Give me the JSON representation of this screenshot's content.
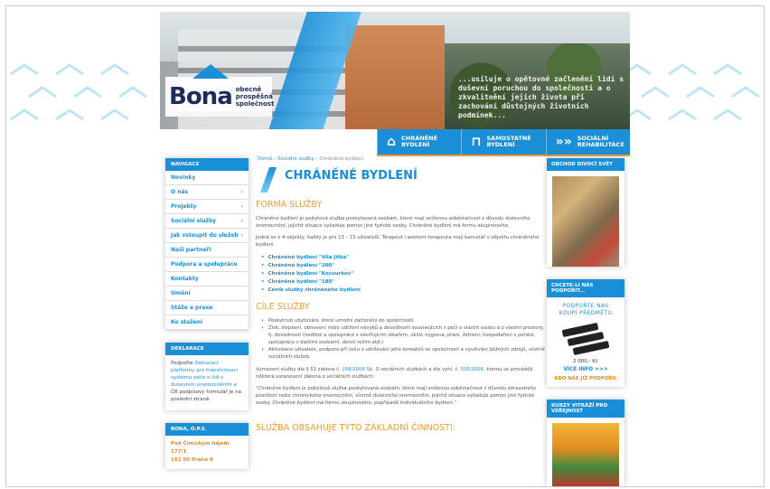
{
  "header": {
    "logo_name": "Bona",
    "logo_tag_1": "obecně",
    "logo_tag_2": "prospěšná",
    "logo_tag_3": "společnost",
    "slogan": "...usiluje o opětovné začlenění lidí s duševní poruchou do společnosti a o zkvalitnění jejich života při zachování důstojných životních podmínek..."
  },
  "topnav": [
    {
      "label_1": "CHRÁNĚNÉ",
      "label_2": "BYDLENÍ",
      "icon": "house-icon"
    },
    {
      "label_1": "SAMOSTATNÉ",
      "label_2": "BYDLENÍ",
      "icon": "door-icon"
    },
    {
      "label_1": "SOCIÁLNÍ",
      "label_2": "REHABILITACE",
      "icon": "chevrons-icon"
    }
  ],
  "sidebar": {
    "heading": "NAVIGACE",
    "items": [
      {
        "label": "Novinky",
        "arrow": ""
      },
      {
        "label": "O nás",
        "arrow": "›"
      },
      {
        "label": "Projekty",
        "arrow": "›"
      },
      {
        "label": "Sociální služby",
        "arrow": "›"
      },
      {
        "label": "Jak vstoupit do služeb",
        "arrow": "›"
      },
      {
        "label": "Naši partneři",
        "arrow": ""
      },
      {
        "label": "Podpora a spolupráce",
        "arrow": ""
      },
      {
        "label": "Kontakty",
        "arrow": ""
      },
      {
        "label": "Umění",
        "arrow": ""
      },
      {
        "label": "Stáže a praxe",
        "arrow": ""
      },
      {
        "label": "Ke stažení",
        "arrow": ""
      }
    ],
    "declaration": {
      "heading": "DEKLARACE",
      "text_1": "Podpořte",
      "link": "Deklaraci platformy pro transformaci systému péče o lidi s duševním onemocněním",
      "text_2": "v ČR podpisový formulář je na poslední straně."
    },
    "contact": {
      "heading": "BONA, O.P.S.",
      "line_1": "Pod Čimickým hájem 177/1",
      "line_2": "181 00 Praha 8"
    }
  },
  "main": {
    "breadcrumb_home": "Domů",
    "breadcrumb_sep": "›",
    "breadcrumb_parent": "Sociální služby",
    "breadcrumb_current": "Chráněné bydlení",
    "title": "CHRÁNĚNÉ BYDLENÍ",
    "section1": "FORMA SLUŽBY",
    "p1": "Chráněné bydlení je pobytová služba poskytovaná osobám, které mají sníženou soběstačnost z důvodu duševního onemocnění, jejichž situace vyžaduje pomoc jiné fyzické osoby. Chráněné bydlení má formu skupinového.",
    "p2": "Jedná se o 4 objekty, každý je pro 13 – 15 uživatelů. Terapeut i asistent terapeuta mají kancelář v objektu chráněného bydlení.",
    "links": [
      "Chráněné bydlení \"Vila Jitka\"",
      "Chráněné bydlení \"200\"",
      "Chráněné bydlení \"Kocourkov\"",
      "Chráněné bydlení \"180\"",
      "Ceník služby chráněného bydlení"
    ],
    "section2": "CÍLE SLUŽBY",
    "goals": [
      "Poskytnutí ubytování, které umožní začlenění do společnosti.",
      "Získ, zlepšení, obnovení nebo udržení návyků a dovedností souvisejících s péčí o vlastní osobu a o vlastní prostory, tj. dovednosti (nedílné a spolupráce s ošetřujícím lékařem, úklid, hygiena, praní, žehlení, hospodaření s penězi, spolupráce s dalšími osobami, denní režim atd.)",
      "Aktivizace uživatele, podpora při úsilu o udržování jeho kontaktů se společností a využívání běžných zdrojů, včetně sociálních služeb."
    ],
    "p3_a": "Vymezení služby dle § 51 zákona č.",
    "p3_link1": "108/2006 Sb.",
    "p3_b": "O sociálních službách a dle vyhl. č.",
    "p3_link2": "505/2006",
    "p3_c": ", kterou se provádějí některá ustanovení zákona o sociálních službách:",
    "p4": "\"Chráněné bydlení je pobytová služba poskytovaná osobám, které mají sníženou soběstačnost z důvodu zdravotního postižení nebo chronického onemocnění, včetně duševního onemocnění, jejichž situace vyžaduje pomoc jiné fyzické osoby. Chráněné bydlení má formu skupinového, popřípadě individuálního bydlení.\"",
    "section3": "SLUŽBA OBSAHUJE TYTO ZÁKLADNÍ ČINNOSTI:"
  },
  "right": {
    "shop_heading": "OBCHOD DIVOCÍ SVĚT",
    "support_heading": "CHCETE-LI NÁS PODPOŘIT...",
    "support_text_1": "PODPOŘTE NÁS",
    "support_text_2": "KOUPÍ PŘEDMĚTU",
    "price": "2 000,- Kč",
    "more": "VÍCE INFO >>>",
    "buy": "KDO NÁS JIŽ PODPOŘIL",
    "glass_heading": "KURZY VITRÁŽÍ PRO VEŘEJNOST"
  },
  "colors": {
    "accent": "#1a8fd8",
    "orange": "#f29b2c"
  }
}
